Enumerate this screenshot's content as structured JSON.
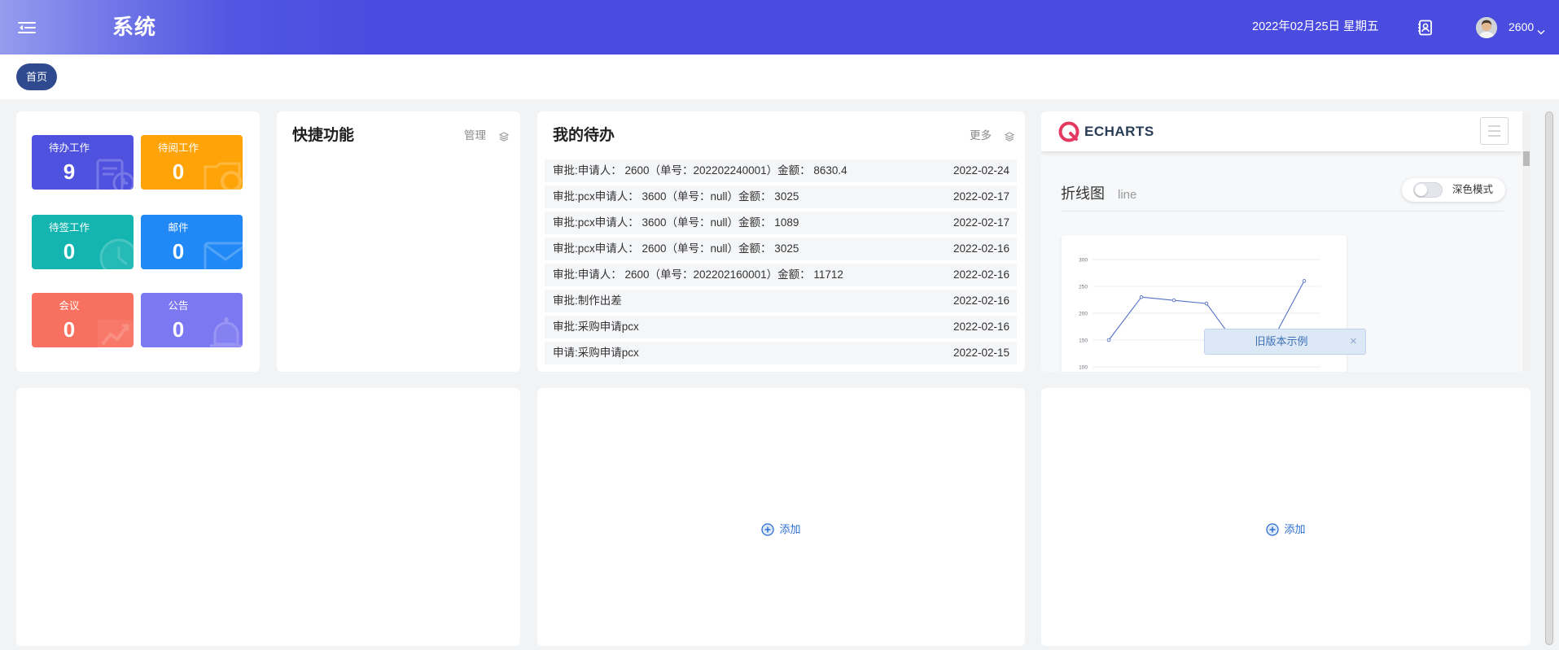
{
  "header": {
    "title": "系统",
    "date": "2022年02月25日 星期五",
    "username": "2600",
    "menu_icon": "menu-fold-icon",
    "contacts_icon": "contact-card-icon",
    "avatar_icon": "user-avatar",
    "dropdown_icon": "chevron-down-icon"
  },
  "tabs": [
    {
      "label": "首页",
      "active": true
    }
  ],
  "stats": [
    {
      "label": "待办工作",
      "count": "9",
      "color": "#4f51df",
      "icon": "todo-doc-icon"
    },
    {
      "label": "待阅工作",
      "count": "0",
      "color": "#ffa408",
      "icon": "read-folder-icon"
    },
    {
      "label": "待签工作",
      "count": "0",
      "color": "#14b5b0",
      "icon": "clock-icon"
    },
    {
      "label": "邮件",
      "count": "0",
      "color": "#2189f5",
      "icon": "mail-icon"
    },
    {
      "label": "会议",
      "count": "0",
      "color": "#f8705f",
      "icon": "trend-icon"
    },
    {
      "label": "公告",
      "count": "0",
      "color": "#7b78f2",
      "icon": "bell-icon"
    }
  ],
  "shortcuts": {
    "title": "快捷功能",
    "manage_label": "管理",
    "manage_icon": "layers-icon"
  },
  "todo": {
    "title": "我的待办",
    "more_label": "更多",
    "more_icon": "layers-icon",
    "items": [
      {
        "text": "审批:申请人： 2600（单号：202202240001）金额： 8630.4",
        "date": "2022-02-24"
      },
      {
        "text": "审批:pcx申请人： 3600（单号：null）金额： 3025",
        "date": "2022-02-17"
      },
      {
        "text": "审批:pcx申请人： 3600（单号：null）金额： 1089",
        "date": "2022-02-17"
      },
      {
        "text": "审批:pcx申请人： 2600（单号：null）金额： 3025",
        "date": "2022-02-16"
      },
      {
        "text": "审批:申请人： 2600（单号：202202160001）金额： 11712",
        "date": "2022-02-16"
      },
      {
        "text": "审批:制作出差",
        "date": "2022-02-16"
      },
      {
        "text": "审批:采购申请pcx",
        "date": "2022-02-16"
      },
      {
        "text": "申请:采购申请pcx",
        "date": "2022-02-15"
      }
    ]
  },
  "echarts": {
    "logo_text": "ECHARTS",
    "menu_icon": "hamburger-icon",
    "section_title": "折线图",
    "section_subtitle": "line",
    "dark_mode_label": "深色模式",
    "dark_mode_on": false,
    "notice": "旧版本示例",
    "notice_close": "×"
  },
  "chart_data": {
    "type": "line",
    "values": [
      150,
      230,
      224,
      218,
      135,
      147,
      260
    ],
    "yticks": [
      "300",
      "250",
      "200",
      "150",
      "100"
    ],
    "ylim": [
      100,
      300
    ],
    "grid": true,
    "color": "#5470c6",
    "title": "",
    "xlabel": "",
    "ylabel": ""
  },
  "panels": {
    "middle": {
      "add_label": "添加",
      "add_icon": "plus-circle-icon"
    },
    "right": {
      "add_label": "添加",
      "add_icon": "plus-circle-icon"
    }
  },
  "colors": {
    "header": "#4a4cdf",
    "active_tab": "#2f4a8e",
    "link": "#2b6fd3",
    "echarts_logo": "#e43961"
  }
}
